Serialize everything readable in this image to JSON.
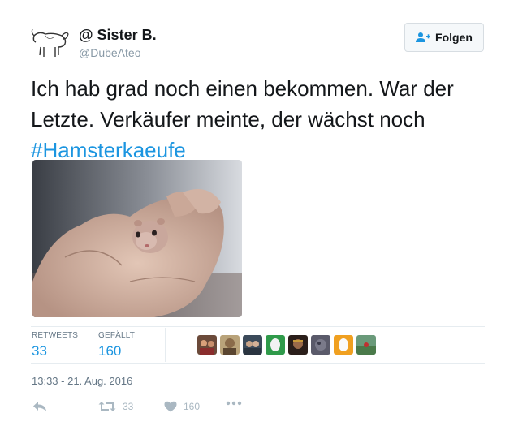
{
  "author": {
    "name": "@ Sister B.",
    "handle": "@DubeAteo"
  },
  "follow_button": {
    "label": "Folgen",
    "icon": "add-user-icon"
  },
  "tweet": {
    "text_line1": "Ich hab grad noch einen bekommen. War der",
    "text_line2": "Letzte. Verkäufer meinte, der wächst noch",
    "hashtag": "#Hamsterkaeufe",
    "media": "photo-hamster-in-hand"
  },
  "stats": {
    "retweets_label": "RETWEETS",
    "retweets_value": "33",
    "likes_label": "GEFÄLLT",
    "likes_value": "160",
    "liker_avatars": [
      "avatar-1",
      "avatar-2",
      "avatar-3",
      "avatar-4",
      "avatar-5",
      "avatar-6",
      "avatar-7",
      "avatar-8"
    ]
  },
  "timestamp": "13:33 - 21. Aug. 2016",
  "actions": {
    "reply_icon": "reply-icon",
    "retweet_icon": "retweet-icon",
    "retweet_count": "33",
    "like_icon": "heart-icon",
    "like_count": "160",
    "more_icon": "more-dots-icon"
  },
  "colors": {
    "link": "#1b95e0",
    "text": "#14171a",
    "muted": "#657786",
    "icon": "#aab8c2"
  }
}
